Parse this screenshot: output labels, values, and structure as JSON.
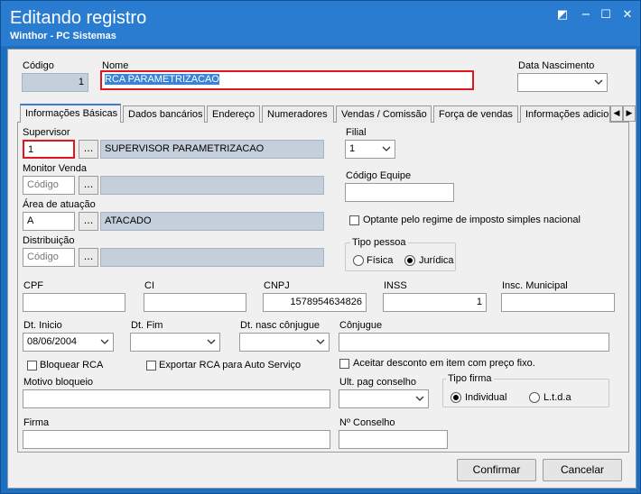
{
  "window": {
    "title": "Editando registro",
    "subtitle": "Winthor - PC Sistemas",
    "restore_glyph": "◩",
    "minimize_glyph": "−",
    "maximize_glyph": "☐",
    "close_glyph": "✕"
  },
  "header": {
    "codigo_label": "Código",
    "codigo_value": "1",
    "nome_label": "Nome",
    "nome_value": "RCA PARAMETRIZACAO",
    "data_nasc_label": "Data Nascimento",
    "data_nasc_value": ""
  },
  "tabs": [
    {
      "label": "Informações Básicas",
      "active": true
    },
    {
      "label": "Dados bancários"
    },
    {
      "label": "Endereço"
    },
    {
      "label": "Numeradores"
    },
    {
      "label": "Vendas  / Comissão"
    },
    {
      "label": "Força de vendas"
    },
    {
      "label": "Informações adicio"
    }
  ],
  "tab_scroll": {
    "left": "◀",
    "right": "▶"
  },
  "form": {
    "supervisor_label": "Supervisor",
    "supervisor_code": "1",
    "supervisor_name": "SUPERVISOR PARAMETRIZACAO",
    "monitor_label": "Monitor Venda",
    "monitor_placeholder": "Código",
    "area_label": "Área de atuação",
    "area_code": "A",
    "area_name": "ATACADO",
    "distrib_label": "Distribuição",
    "distrib_placeholder": "Código",
    "dots": "...",
    "filial_label": "Filial",
    "filial_value": "1",
    "codigo_equipe_label": "Código Equipe",
    "optante_label": "Optante pelo regime de imposto simples nacional",
    "tipo_pessoa_label": "Tipo pessoa",
    "fisica_label": "Física",
    "juridica_label": "Jurídica",
    "cpf_label": "CPF",
    "ci_label": "CI",
    "cnpj_label": "CNPJ",
    "cnpj_value": "1578954634826",
    "inss_label": "INSS",
    "inss_value": "1",
    "insc_mun_label": "Insc. Municipal",
    "dt_inicio_label": "Dt. Inicio",
    "dt_inicio_value": "08/06/2004",
    "dt_fim_label": "Dt. Fim",
    "dt_nasc_conj_label": "Dt. nasc cônjugue",
    "conjugue_label": "Cônjugue",
    "bloquear_label": "Bloquear RCA",
    "exportar_label": "Exportar RCA para Auto Serviço",
    "aceitar_label": "Aceitar desconto em item com preço fixo.",
    "motivo_label": "Motivo bloqueio",
    "ult_pag_label": "Ult. pag conselho",
    "tipo_firma_label": "Tipo firma",
    "individual_label": "Individual",
    "ltda_label": "L.t.d.a",
    "firma_label": "Firma",
    "no_conselho_label": "Nº Conselho"
  },
  "buttons": {
    "confirmar": "Confirmar",
    "cancelar": "Cancelar"
  }
}
